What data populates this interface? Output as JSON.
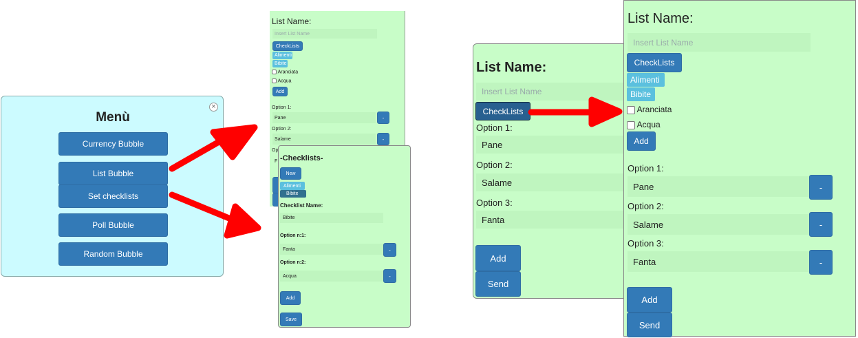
{
  "menu": {
    "title": "Menù",
    "close_glyph": "×",
    "items": [
      "Currency Bubble",
      "List Bubble",
      "Set checklists",
      "Poll Bubble",
      "Random Bubble"
    ]
  },
  "list_form": {
    "heading": "List Name:",
    "placeholder": "Insert List Name",
    "checklists_button": "CheckLists",
    "tags": [
      "Alimenti",
      "Bibite"
    ],
    "checkboxes": [
      "Aranciata",
      "Acqua"
    ],
    "add_label": "Add",
    "options": [
      {
        "label": "Option 1:",
        "value": "Pane"
      },
      {
        "label": "Option 2:",
        "value": "Salame"
      },
      {
        "label": "Option 3:",
        "value": "Fanta"
      }
    ],
    "remove_label": "-",
    "send_label": "Send",
    "cut_option_prefix": "Op",
    "cut_value": "F"
  },
  "checklists_form": {
    "heading": "-Checklists-",
    "new_label": "New",
    "tags": [
      "Alimenti",
      "Bibite"
    ],
    "name_label": "Checklist Name:",
    "name_value": "Bibite",
    "options": [
      {
        "label": "Option n:1:",
        "value": "Fanta"
      },
      {
        "label": "Option n:2:",
        "value": "Acqua"
      }
    ],
    "remove_label": "-",
    "add_label": "Add",
    "save_label": "Save"
  },
  "colors": {
    "menu_bg": "#ccfbff",
    "panel_bg": "#c8fdc8",
    "button": "#337ab7",
    "tag": "#5bc0de",
    "arrow": "#ff0000"
  }
}
